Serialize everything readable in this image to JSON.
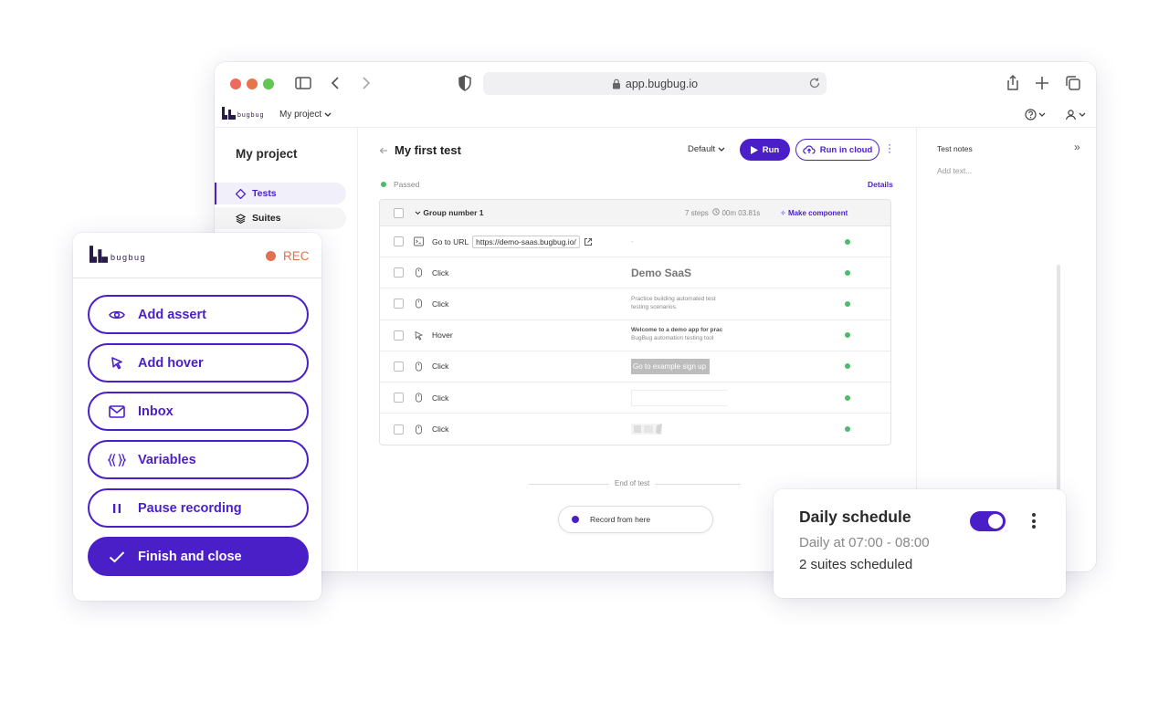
{
  "browser": {
    "url": "app.bugbug.io"
  },
  "appbar": {
    "logo_word": "bugbug",
    "project_select": "My project"
  },
  "sidebar": {
    "title": "My project",
    "items": [
      {
        "label": "Tests",
        "icon": "diamond-icon",
        "active": true
      },
      {
        "label": "Suites",
        "icon": "layers-icon",
        "active": false
      }
    ]
  },
  "test": {
    "title": "My first test",
    "profile": "Default",
    "run_label": "Run",
    "run_cloud_label": "Run in cloud",
    "status": "Passed",
    "details_label": "Details",
    "group": {
      "name": "Group number 1",
      "steps_count": "7 steps",
      "duration": "00m 03.81s",
      "make_component": "Make component"
    },
    "steps": [
      {
        "type": "Go to URL",
        "icon": "terminal-icon",
        "url": "https://demo-saas.bugbug.io/",
        "preview": "-"
      },
      {
        "type": "Click",
        "icon": "mouse-icon",
        "preview": "Demo SaaS"
      },
      {
        "type": "Click",
        "icon": "mouse-icon",
        "preview_line1": "Practice building automated test",
        "preview_line2": "testing scenarios."
      },
      {
        "type": "Hover",
        "icon": "cursor-icon",
        "preview_line1": "Welcome to a demo app for prac",
        "preview_line2": "BugBug automation testing tool"
      },
      {
        "type": "Click",
        "icon": "mouse-icon",
        "preview": "Go to example sign up"
      },
      {
        "type": "Click",
        "icon": "mouse-icon",
        "preview": ""
      },
      {
        "type": "Click",
        "icon": "mouse-icon",
        "preview": ""
      }
    ],
    "end_label": "End of test",
    "record_label": "Record from here"
  },
  "notes": {
    "title": "Test notes",
    "placeholder": "Add text..."
  },
  "recorder": {
    "logo_word": "bugbug",
    "rec_label": "REC",
    "actions": [
      {
        "label": "Add assert",
        "icon": "eye-icon"
      },
      {
        "label": "Add hover",
        "icon": "cursor-icon"
      },
      {
        "label": "Inbox",
        "icon": "envelope-icon"
      },
      {
        "label": "Variables",
        "icon": "braces-icon"
      },
      {
        "label": "Pause recording",
        "icon": "pause-icon"
      },
      {
        "label": "Finish and close",
        "icon": "check-icon"
      }
    ]
  },
  "schedule": {
    "title": "Daily schedule",
    "time": "Daily at 07:00 - 08:00",
    "suites": "2 suites scheduled",
    "enabled": true
  },
  "colors": {
    "accent": "#4b1fc7",
    "rec": "#e07050",
    "passed": "#4dba6b"
  }
}
